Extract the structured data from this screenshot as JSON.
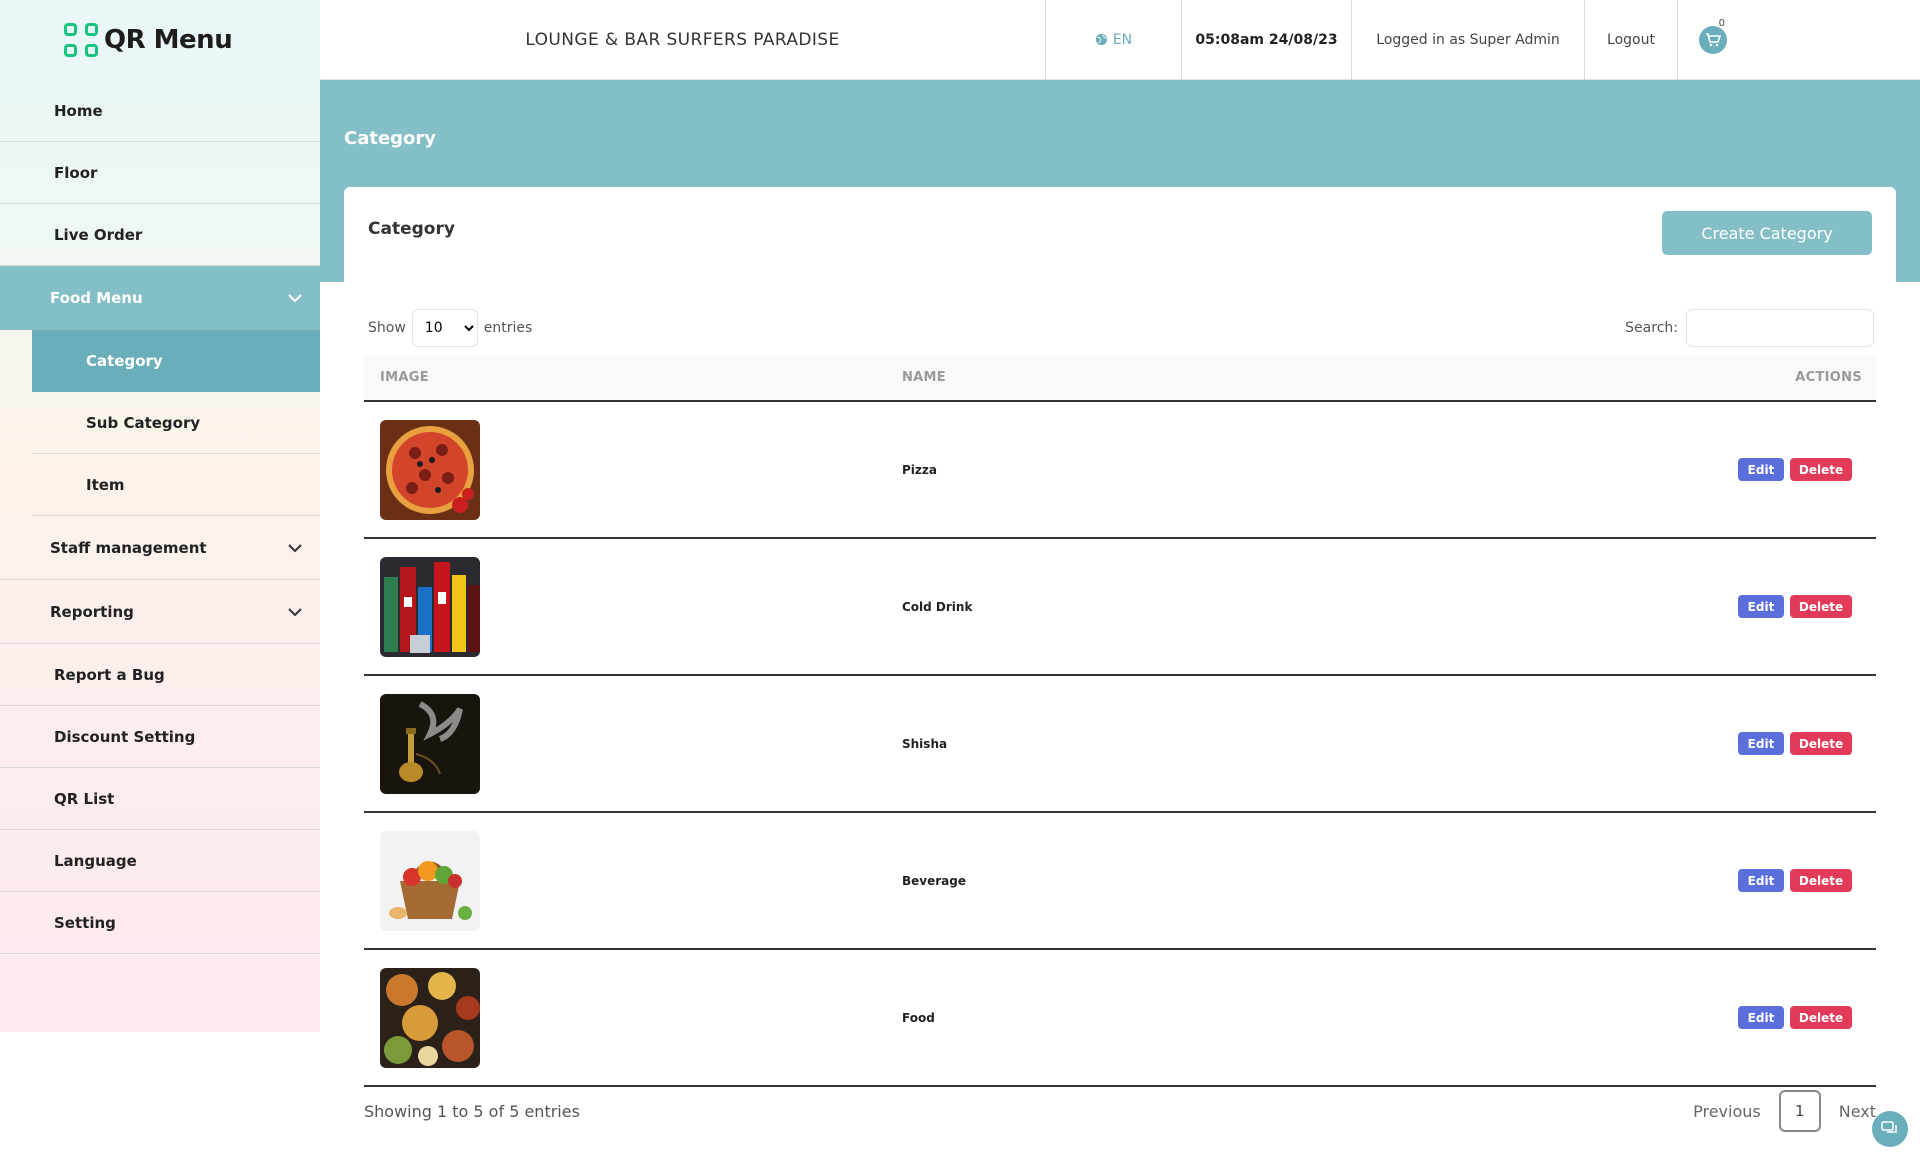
{
  "sidebar": {
    "logo_text": "QR Menu",
    "items": [
      {
        "label": "Home"
      },
      {
        "label": "Floor"
      },
      {
        "label": "Live Order"
      },
      {
        "label": "Food Menu"
      },
      {
        "label": "Category"
      },
      {
        "label": "Sub Category"
      },
      {
        "label": "Item"
      },
      {
        "label": "Staff management"
      },
      {
        "label": "Reporting"
      },
      {
        "label": "Report a Bug"
      },
      {
        "label": "Discount Setting"
      },
      {
        "label": "QR List"
      },
      {
        "label": "Language"
      },
      {
        "label": "Setting"
      }
    ]
  },
  "header": {
    "venue": "LOUNGE & BAR SURFERS PARADISE",
    "language": "EN",
    "datetime": "05:08am 24/08/23",
    "user": "Logged in as Super Admin",
    "logout": "Logout",
    "cart_count": "0"
  },
  "page": {
    "banner_title": "Category",
    "card_title": "Category",
    "create_button": "Create Category",
    "show_label": "Show",
    "entries_label": "entries",
    "entries_value": "10",
    "search_label": "Search:"
  },
  "table": {
    "headers": [
      "IMAGE",
      "NAME",
      "ACTIONS"
    ],
    "edit_label": "Edit",
    "delete_label": "Delete",
    "rows": [
      {
        "name": "Pizza"
      },
      {
        "name": "Cold Drink"
      },
      {
        "name": "Shisha"
      },
      {
        "name": "Beverage"
      },
      {
        "name": "Food"
      }
    ]
  },
  "footer": {
    "info": "Showing 1 to 5 of 5 entries",
    "previous": "Previous",
    "page": "1",
    "next": "Next"
  },
  "colors": {
    "accent": "#84bfc7",
    "accent_dark": "#6aaebb",
    "edit": "#5b6fdc",
    "delete": "#e23b5a",
    "logo": "#19c37d"
  }
}
